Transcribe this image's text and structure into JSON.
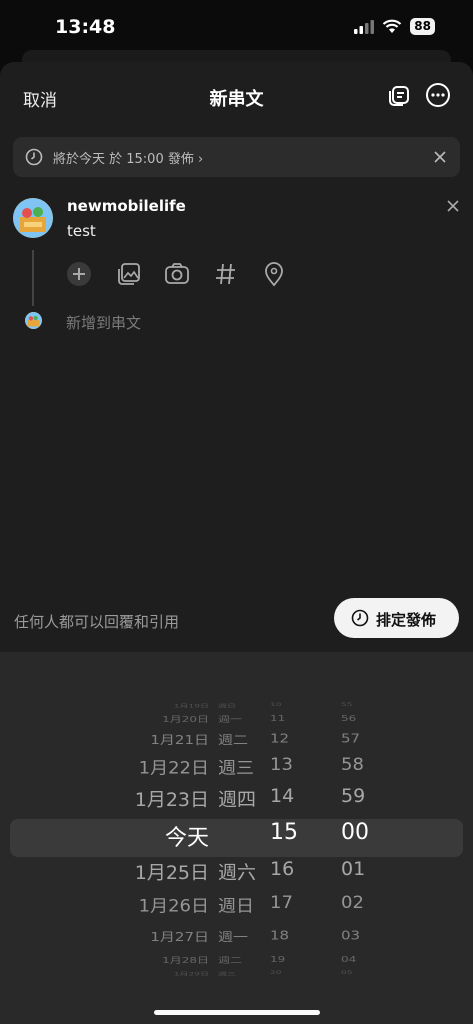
{
  "status_bar": {
    "time": "13:48",
    "battery": "88"
  },
  "header": {
    "cancel": "取消",
    "title": "新串文"
  },
  "schedule_banner": {
    "text": "將於今天 於 15:00 發佈 ›"
  },
  "post": {
    "username": "newmobilelife",
    "text": "test",
    "add_thread": "新增到串文"
  },
  "footer": {
    "reply_permission": "任何人都可以回覆和引用",
    "schedule_button": "排定發佈"
  },
  "picker": {
    "rows": [
      {
        "date": "1月19日",
        "weekday": "週日",
        "hour": "10",
        "minute": "55"
      },
      {
        "date": "1月20日",
        "weekday": "週一",
        "hour": "11",
        "minute": "56"
      },
      {
        "date": "1月21日",
        "weekday": "週二",
        "hour": "12",
        "minute": "57"
      },
      {
        "date": "1月22日",
        "weekday": "週三",
        "hour": "13",
        "minute": "58"
      },
      {
        "date": "1月23日",
        "weekday": "週四",
        "hour": "14",
        "minute": "59"
      },
      {
        "date": "今天",
        "weekday": "",
        "hour": "15",
        "minute": "00"
      },
      {
        "date": "1月25日",
        "weekday": "週六",
        "hour": "16",
        "minute": "01"
      },
      {
        "date": "1月26日",
        "weekday": "週日",
        "hour": "17",
        "minute": "02"
      },
      {
        "date": "1月27日",
        "weekday": "週一",
        "hour": "18",
        "minute": "03"
      },
      {
        "date": "1月28日",
        "weekday": "週二",
        "hour": "19",
        "minute": "04"
      },
      {
        "date": "1月29日",
        "weekday": "週三",
        "hour": "20",
        "minute": "05"
      }
    ]
  }
}
